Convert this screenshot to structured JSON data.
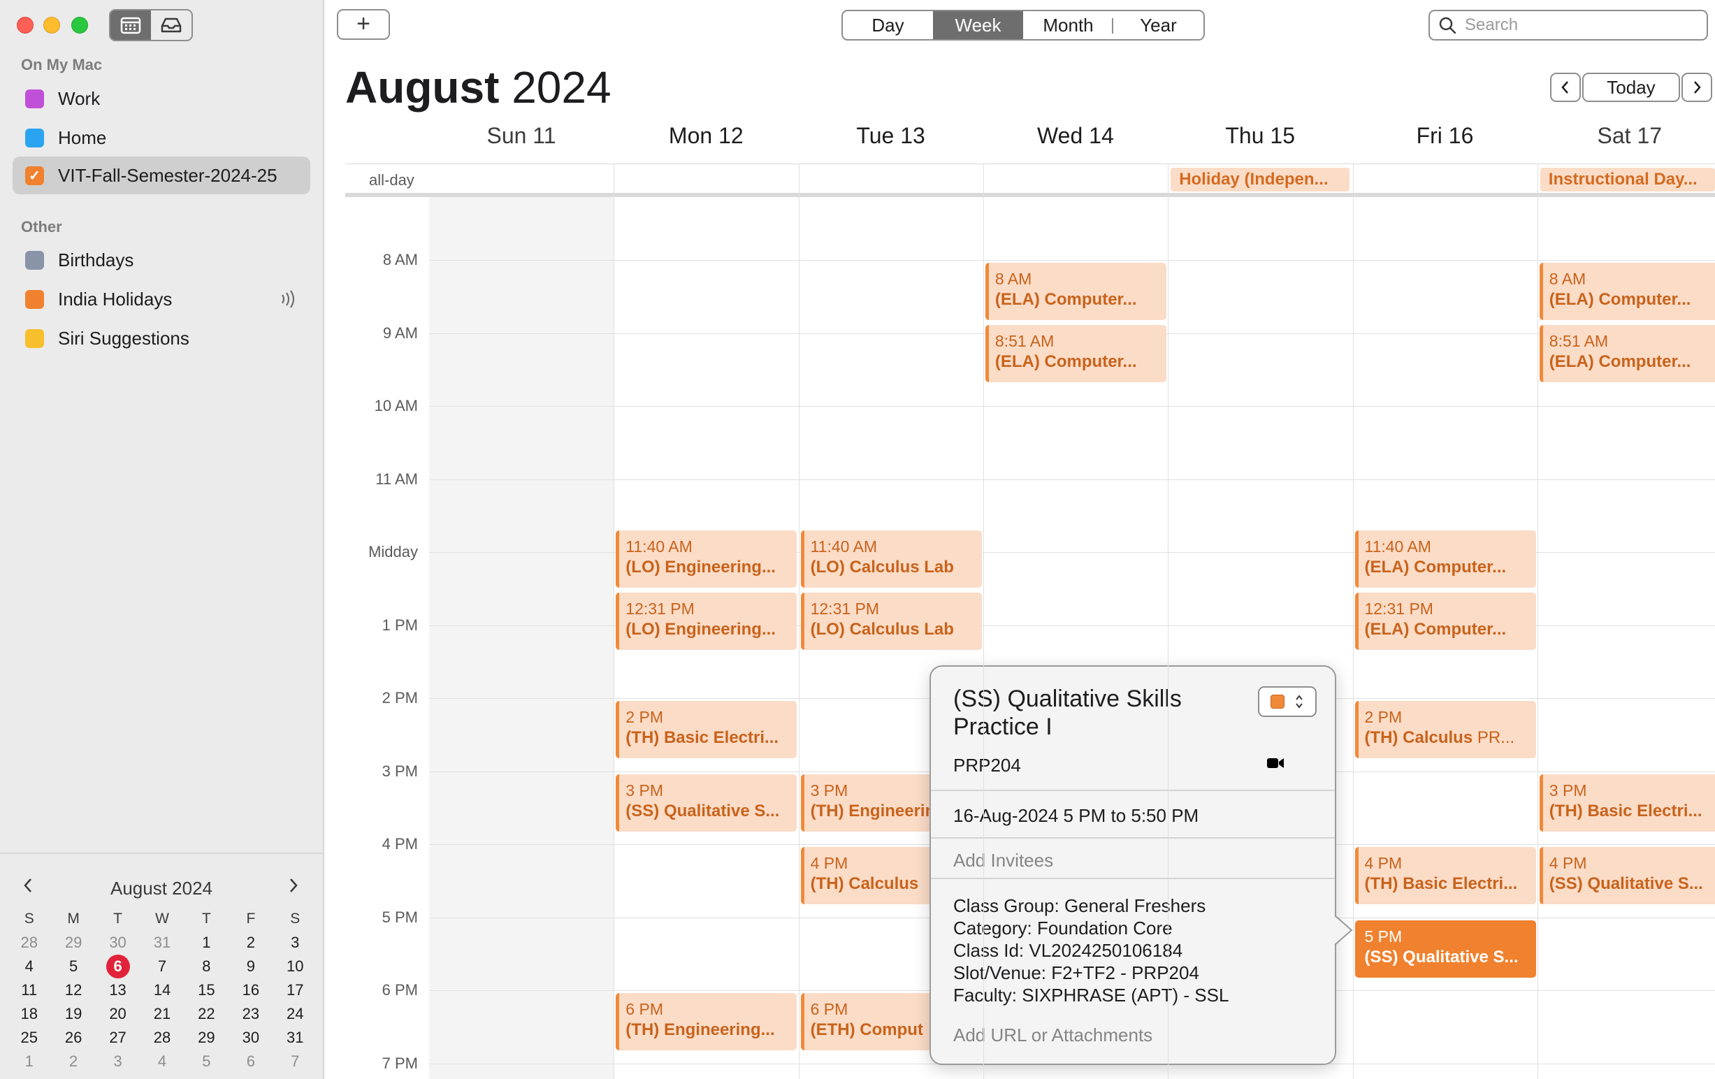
{
  "sidebar": {
    "section_mac": "On My Mac",
    "section_other": "Other",
    "calendars_mac": [
      {
        "label": "Work",
        "color": "#c150d8"
      },
      {
        "label": "Home",
        "color": "#2aa4f0"
      },
      {
        "label": "VIT-Fall-Semester-2024-25",
        "color": "#f0812e",
        "checked": true
      }
    ],
    "calendars_other": [
      {
        "label": "Birthdays",
        "color": "#8a94a8"
      },
      {
        "label": "India Holidays",
        "color": "#f0812e"
      },
      {
        "label": "Siri Suggestions",
        "color": "#f8bf2c"
      }
    ]
  },
  "mini_calendar": {
    "title": "August 2024",
    "weekdays": [
      "S",
      "M",
      "T",
      "W",
      "T",
      "F",
      "S"
    ],
    "weeks": [
      [
        "28",
        "29",
        "30",
        "31",
        "1",
        "2",
        "3"
      ],
      [
        "4",
        "5",
        "6",
        "7",
        "8",
        "9",
        "10"
      ],
      [
        "11",
        "12",
        "13",
        "14",
        "15",
        "16",
        "17"
      ],
      [
        "18",
        "19",
        "20",
        "21",
        "22",
        "23",
        "24"
      ],
      [
        "25",
        "26",
        "27",
        "28",
        "29",
        "30",
        "31"
      ],
      [
        "1",
        "2",
        "3",
        "4",
        "5",
        "6",
        "7"
      ]
    ],
    "today": "6"
  },
  "toolbar": {
    "add_label": "+",
    "views": [
      "Day",
      "Week",
      "Month",
      "Year"
    ],
    "active_view": "Week",
    "search_placeholder": "Search"
  },
  "header": {
    "month": "August",
    "year": "2024",
    "today_label": "Today",
    "prev_label": "<",
    "next_label": ">"
  },
  "days": [
    "Sun 11",
    "Mon 12",
    "Tue 13",
    "Wed 14",
    "Thu 15",
    "Fri 16",
    "Sat 17"
  ],
  "allday": {
    "label": "all-day",
    "events": [
      {
        "day": 4,
        "title": "Holiday (Indepen..."
      },
      {
        "day": 6,
        "title": "Instructional Day..."
      }
    ]
  },
  "hours": [
    "8 AM",
    "9 AM",
    "10 AM",
    "11 AM",
    "Midday",
    "1 PM",
    "2 PM",
    "3 PM",
    "4 PM",
    "5 PM",
    "6 PM",
    "7 PM"
  ],
  "events": [
    {
      "day": 3,
      "start": 8.0,
      "time": "8 AM",
      "title": "(ELA) Computer..."
    },
    {
      "day": 3,
      "start": 8.85,
      "time": "8:51 AM",
      "title": "(ELA) Computer..."
    },
    {
      "day": 6,
      "start": 8.0,
      "time": "8 AM",
      "title": "(ELA) Computer..."
    },
    {
      "day": 6,
      "start": 8.85,
      "time": "8:51 AM",
      "title": "(ELA) Computer..."
    },
    {
      "day": 1,
      "start": 11.667,
      "time": "11:40 AM",
      "title": "(LO) Engineering..."
    },
    {
      "day": 2,
      "start": 11.667,
      "time": "11:40 AM",
      "title": "(LO) Calculus Lab"
    },
    {
      "day": 5,
      "start": 11.667,
      "time": "11:40 AM",
      "title": "(ELA) Computer..."
    },
    {
      "day": 1,
      "start": 12.517,
      "time": "12:31 PM",
      "title": "(LO) Engineering..."
    },
    {
      "day": 2,
      "start": 12.517,
      "time": "12:31 PM",
      "title": "(LO) Calculus Lab"
    },
    {
      "day": 5,
      "start": 12.517,
      "time": "12:31 PM",
      "title": "(ELA) Computer..."
    },
    {
      "day": 1,
      "start": 14.0,
      "time": "2 PM",
      "title": "(TH) Basic Electri..."
    },
    {
      "day": 5,
      "start": 14.0,
      "time": "2 PM",
      "title": "(TH) Calculus",
      "extra": "PR..."
    },
    {
      "day": 1,
      "start": 15.0,
      "time": "3 PM",
      "title": "(SS) Qualitative S..."
    },
    {
      "day": 2,
      "start": 15.0,
      "time": "3 PM",
      "title": "(TH) Engineerin"
    },
    {
      "day": 6,
      "start": 15.0,
      "time": "3 PM",
      "title": "(TH) Basic Electri..."
    },
    {
      "day": 2,
      "start": 16.0,
      "time": "4 PM",
      "title": "(TH) Calculus"
    },
    {
      "day": 5,
      "start": 16.0,
      "time": "4 PM",
      "title": "(TH) Basic Electri..."
    },
    {
      "day": 6,
      "start": 16.0,
      "time": "4 PM",
      "title": "(SS) Qualitative S..."
    },
    {
      "day": 5,
      "start": 17.0,
      "time": "5 PM",
      "title": "(SS) Qualitative S...",
      "active": true
    },
    {
      "day": 1,
      "start": 18.0,
      "time": "6 PM",
      "title": "(TH) Engineering..."
    },
    {
      "day": 2,
      "start": 18.0,
      "time": "6 PM",
      "title": "(ETH) Comput"
    }
  ],
  "popover": {
    "title": "(SS) Qualitative Skills Practice I",
    "location": "PRP204",
    "when": "16-Aug-2024  5 PM to 5:50 PM",
    "invitees_placeholder": "Add Invitees",
    "notes": [
      "Class Group: General Freshers",
      "Category: Foundation Core",
      "Class Id: VL2024250106184",
      "Slot/Venue: F2+TF2 - PRP204",
      "Faculty: SIXPHRASE (APT) - SSL"
    ],
    "url_placeholder": "Add URL or Attachments",
    "color": "#f08a3a"
  }
}
